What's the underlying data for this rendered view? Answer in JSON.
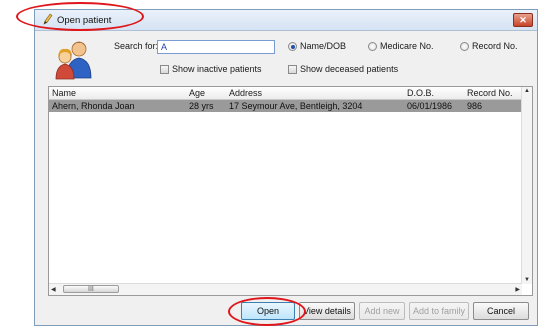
{
  "window": {
    "title": "Open patient",
    "close_glyph": "✕"
  },
  "search": {
    "label": "Search for:",
    "value": "A",
    "options": [
      "Name/DOB",
      "Medicare No.",
      "Record No."
    ],
    "selected": "Name/DOB",
    "show_inactive_label": "Show inactive patients",
    "show_deceased_label": "Show deceased patients"
  },
  "table": {
    "columns": [
      "Name",
      "Age",
      "Address",
      "D.O.B.",
      "Record No."
    ],
    "rows": [
      {
        "name": "Ahern, Rhonda Joan",
        "age": "28 yrs",
        "address": "17 Seymour Ave, Bentleigh, 3204",
        "dob": "06/01/1986",
        "record": "986"
      }
    ],
    "scroll_grip": "III"
  },
  "buttons": {
    "open": "Open",
    "view_details": "View details",
    "add_new": "Add new",
    "add_to_family": "Add to family",
    "cancel": "Cancel"
  },
  "colors": {
    "annotation": "#e0161b",
    "selection": "#9a9a9a",
    "titlebar": "#dbe6f4"
  }
}
